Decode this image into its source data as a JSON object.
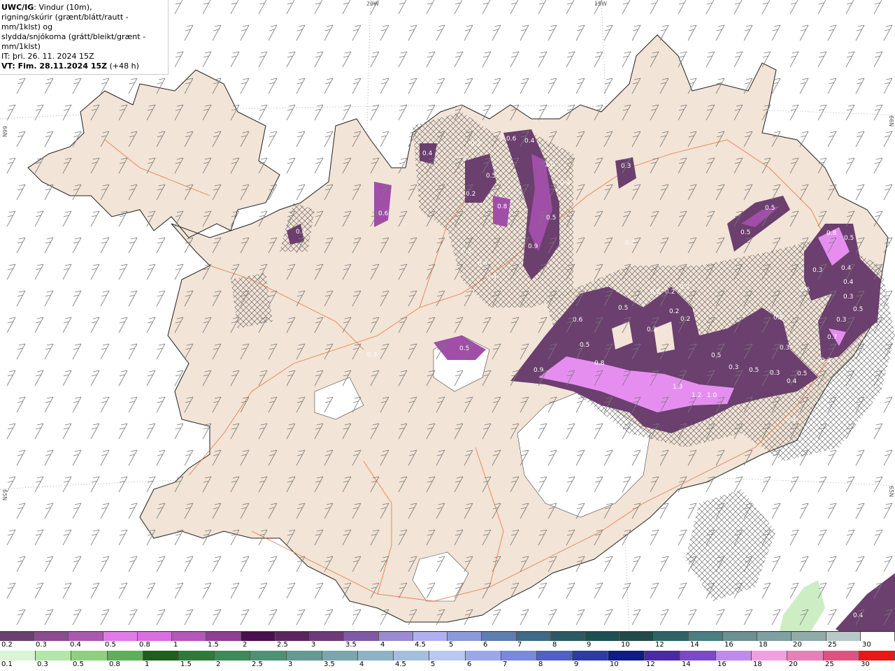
{
  "header": {
    "title": "UWC/IG",
    "line1_rest": ": Vindur (10m),",
    "line2": "rigning/skúrir (grænt/blátt/rautt - mm/1klst) og",
    "line3": "slydda/snjókoma (grátt/bleikt/grænt - mm/1klst)",
    "line4": "IT: þri. 26. 11. 2024 15Z",
    "line5": "VT: Fim. 28.11.2024 15Z",
    "line5_suffix": " (+48 h)"
  },
  "graticule": {
    "lon_20w": "20W",
    "lon_15w": "15W",
    "lat_66n_left": "66N",
    "lat_66n_right": "66N",
    "lat_65n_left": "65N",
    "lat_65n_right": "65N"
  },
  "colors": {
    "land": "#f2e4d6",
    "sea": "#ffffff",
    "roads": "#e8672a",
    "precip_dark": "#6b3f6e",
    "precip_mid": "#a04ea8",
    "precip_light": "#e68ef0",
    "glacier": "#ffffff",
    "barbs": "#7a7a7a"
  },
  "precip_labels": [
    {
      "v": "0.4"
    },
    {
      "v": "0.3"
    },
    {
      "v": "0.3"
    },
    {
      "v": "0.5"
    },
    {
      "v": "0.6"
    },
    {
      "v": "0.4"
    },
    {
      "v": "1.0"
    },
    {
      "v": "0.4"
    },
    {
      "v": "0.2"
    },
    {
      "v": "0.8"
    },
    {
      "v": "0.5"
    },
    {
      "v": "0.9"
    },
    {
      "v": "0.3"
    },
    {
      "v": "0.4"
    },
    {
      "v": "0.4"
    },
    {
      "v": "0.3"
    },
    {
      "v": "0.6"
    },
    {
      "v": "0.3"
    },
    {
      "v": "0.5"
    },
    {
      "v": "0.5"
    },
    {
      "v": "0.2"
    },
    {
      "v": "0.5"
    },
    {
      "v": "0.8"
    },
    {
      "v": "0.5"
    },
    {
      "v": "0.3"
    },
    {
      "v": "0.4"
    },
    {
      "v": "0.6"
    },
    {
      "v": "0.4"
    },
    {
      "v": "0.3"
    },
    {
      "v": "0.5"
    },
    {
      "v": "0.7"
    },
    {
      "v": "0.3"
    },
    {
      "v": "0.3"
    },
    {
      "v": "0.5"
    },
    {
      "v": "0.6"
    },
    {
      "v": "0.5"
    },
    {
      "v": "0.9"
    },
    {
      "v": "0.8"
    },
    {
      "v": "0.5"
    },
    {
      "v": "0.2"
    },
    {
      "v": "0.2"
    },
    {
      "v": "0.2"
    },
    {
      "v": "0.3"
    },
    {
      "v": "0.2"
    },
    {
      "v": "0.5"
    },
    {
      "v": "0.3"
    },
    {
      "v": "0.5"
    },
    {
      "v": "0.4"
    },
    {
      "v": "0.5"
    },
    {
      "v": "1.3"
    },
    {
      "v": "1.2"
    },
    {
      "v": "1.0"
    },
    {
      "v": "0.3"
    },
    {
      "v": "0.4"
    },
    {
      "v": "0.4"
    },
    {
      "v": "0.3"
    },
    {
      "v": "0.3"
    },
    {
      "v": "0.2"
    }
  ],
  "legend_snow": {
    "labels": [
      "0.2",
      "0.3",
      "0.4",
      "0.5",
      "0.8",
      "1",
      "1.5",
      "2",
      "2.5",
      "3",
      "3.5",
      "4",
      "4.5",
      "5",
      "6",
      "7",
      "8",
      "9",
      "10",
      "12",
      "14",
      "16",
      "18",
      "20",
      "25",
      "30"
    ],
    "colors": [
      "#6b3f6e",
      "#8a4d8e",
      "#a95aae",
      "#e07ae6",
      "#d96fde",
      "#b357b8",
      "#8e3f92",
      "#4a0f4f",
      "#5b2560",
      "#6e3a78",
      "#7f5aa5",
      "#9a8ad0",
      "#b0b0f0",
      "#8a9ad8",
      "#5d7fb0",
      "#3e6a86",
      "#2c5a62",
      "#1e4f52",
      "#234a4a",
      "#2f6466",
      "#4a7e80",
      "#6a9090",
      "#7fa0a0",
      "#90aaa8",
      "#b8c8c8",
      "#ffffff"
    ]
  },
  "legend_rain": {
    "labels": [
      "0.1",
      "0.3",
      "0.5",
      "0.8",
      "1",
      "1.5",
      "2",
      "2.5",
      "3",
      "3.5",
      "4",
      "4.5",
      "5",
      "6",
      "7",
      "8",
      "9",
      "10",
      "12",
      "14",
      "16",
      "18",
      "20",
      "25",
      "30"
    ],
    "colors": [
      "#d9f5d4",
      "#b3e6a8",
      "#8fd07f",
      "#5fae59",
      "#1e5e1e",
      "#2f7a3a",
      "#3e8a58",
      "#4e9276",
      "#649a92",
      "#7aa6ae",
      "#8fb2c6",
      "#a4bede",
      "#b8c8f0",
      "#9aa8ea",
      "#7a88e0",
      "#5060c8",
      "#2e3aa8",
      "#101a8a",
      "#4a2aa8",
      "#7a4ac8",
      "#c08ae8",
      "#f0a0e0",
      "#e880b8",
      "#e05080",
      "#e81818"
    ]
  }
}
